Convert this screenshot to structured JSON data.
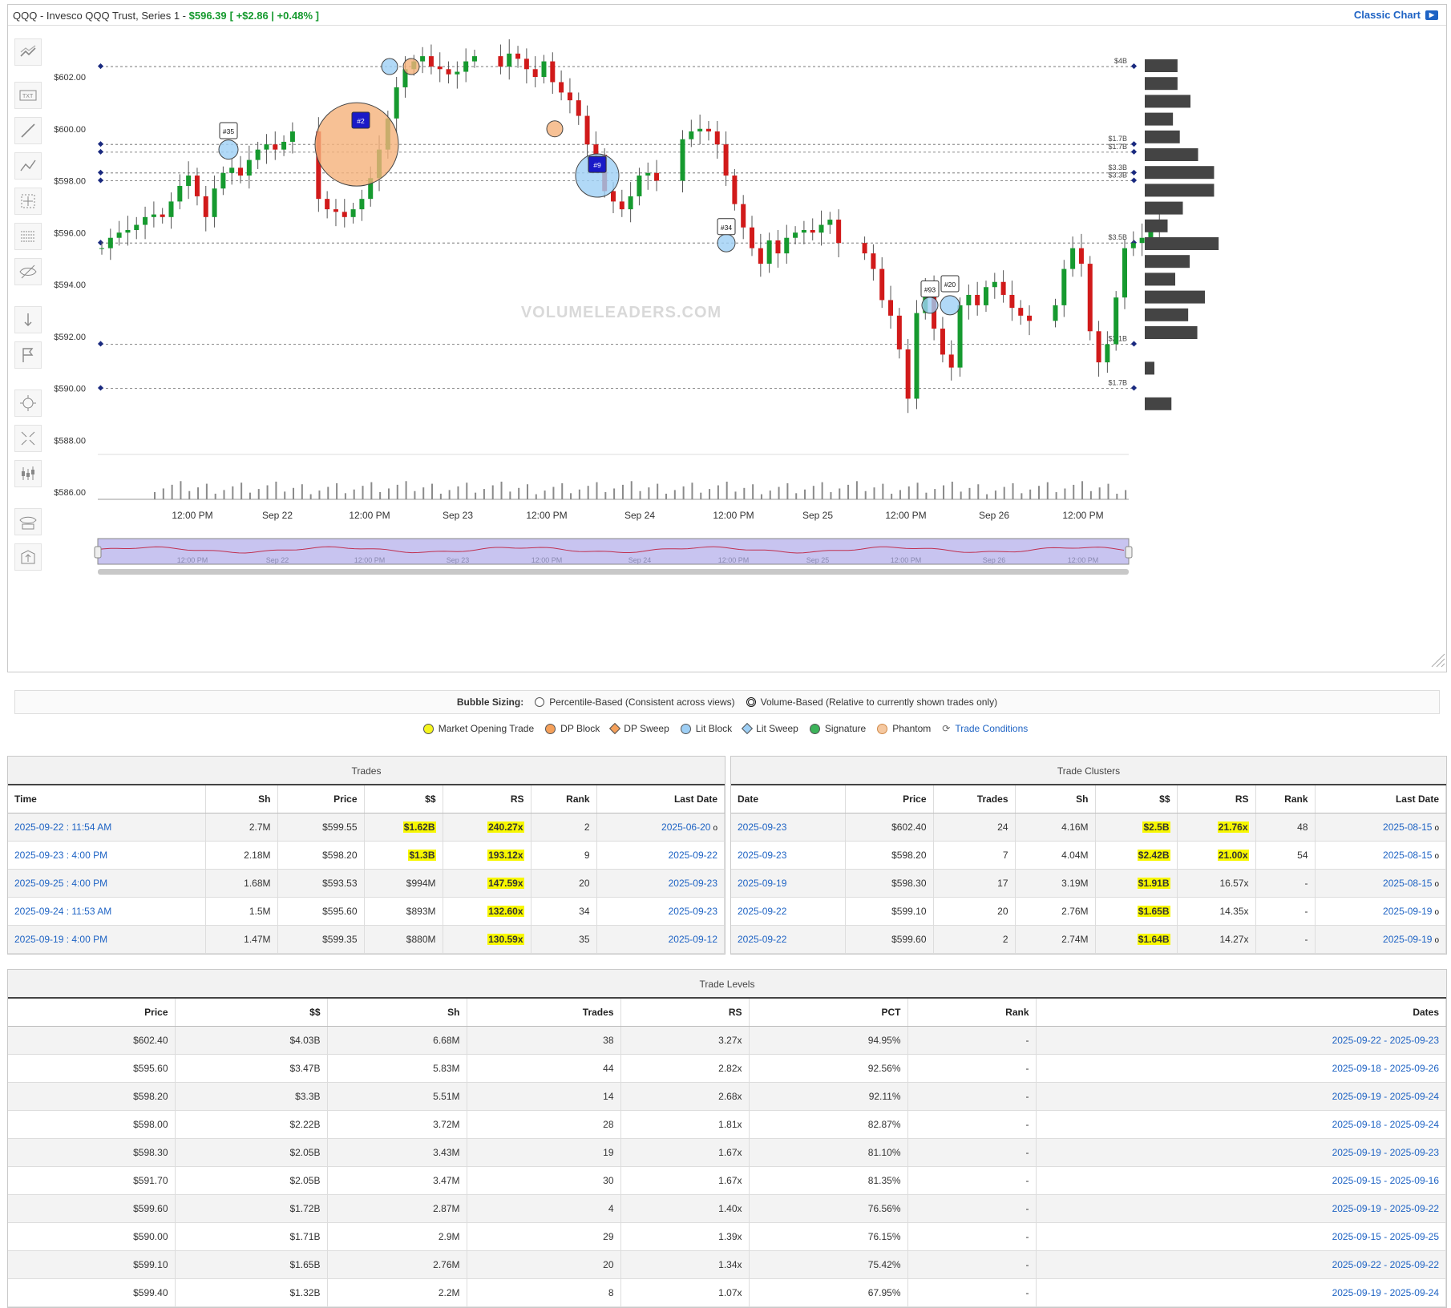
{
  "header": {
    "title_prefix": "QQQ - Invesco QQQ Trust, Series 1  - ",
    "price": "$596.39",
    "change": "[ +$2.86 | +0.48% ]",
    "classic_chart_label": "Classic Chart"
  },
  "chart_data": {
    "type": "candlestick",
    "y_tick_labels": [
      "$602.00",
      "$600.00",
      "$598.00",
      "$596.00",
      "$594.00",
      "$592.00",
      "$590.00",
      "$588.00",
      "$586.00"
    ],
    "ylim": [
      586,
      603
    ],
    "x_tick_labels": [
      "12:00 PM",
      "Sep 22",
      "12:00 PM",
      "Sep 23",
      "12:00 PM",
      "Sep 24",
      "12:00 PM",
      "Sep 25",
      "12:00 PM",
      "Sep 26",
      "12:00 PM"
    ],
    "navigator_labels": [
      "12:00 PM",
      "Sep 22",
      "12:00 PM",
      "Sep 23",
      "12:00 PM",
      "Sep 24",
      "12:00 PM",
      "Sep 25",
      "12:00 PM",
      "Sep 26",
      "12:00 PM"
    ],
    "watermark": "VOLUMELEADERS.COM",
    "levels": [
      {
        "price": 602.4,
        "label": "$4B"
      },
      {
        "price": 599.4,
        "label": "$1.7B"
      },
      {
        "price": 599.1,
        "label": "$1.7B"
      },
      {
        "price": 598.3,
        "label": "$3.3B"
      },
      {
        "price": 598.0,
        "label": "$3.3B"
      },
      {
        "price": 595.6,
        "label": "$3.5B"
      },
      {
        "price": 591.7,
        "label": "$2.1B"
      },
      {
        "price": 590.0,
        "label": "$1.7B"
      }
    ],
    "markers": [
      "#35",
      "#2",
      "#9",
      "#34",
      "#93",
      "#20"
    ],
    "volume_profile": [
      0.43,
      0.43,
      0.6,
      0.37,
      0.46,
      0.7,
      0.91,
      0.91,
      0.5,
      0.3,
      0.97,
      0.59,
      0.4,
      0.79,
      0.57,
      0.69,
      0.0,
      0.1,
      0.0,
      0.35
    ]
  },
  "bubble_sizing": {
    "label": "Bubble Sizing:",
    "option1": "Percentile-Based (Consistent across views)",
    "option2": "Volume-Based (Relative to currently shown trades only)"
  },
  "legend": [
    {
      "label": "Market Opening Trade",
      "color": "#f5f51e",
      "shape": "circle"
    },
    {
      "label": "DP Block",
      "color": "#f5a05a",
      "shape": "circle"
    },
    {
      "label": "DP Sweep",
      "color": "#f5a05a",
      "shape": "diamond"
    },
    {
      "label": "Lit Block",
      "color": "#9ecff5",
      "shape": "circle"
    },
    {
      "label": "Lit Sweep",
      "color": "#9ecff5",
      "shape": "diamond"
    },
    {
      "label": "Signature",
      "color": "#3cb35a",
      "shape": "circle"
    },
    {
      "label": "Phantom",
      "color": "#f5c8a0",
      "shape": "circle"
    }
  ],
  "trade_conditions_label": "Trade Conditions",
  "trades": {
    "title": "Trades",
    "headers": [
      "Time",
      "Sh",
      "Price",
      "$$",
      "RS",
      "Rank",
      "Last Date"
    ],
    "rows": [
      [
        "2025-09-22 : 11:54 AM",
        "2.7M",
        "$599.55",
        "$1.62B",
        "240.27x",
        "2",
        "2025-06-20"
      ],
      [
        "2025-09-23 : 4:00 PM",
        "2.18M",
        "$598.20",
        "$1.3B",
        "193.12x",
        "9",
        "2025-09-22"
      ],
      [
        "2025-09-25 : 4:00 PM",
        "1.68M",
        "$593.53",
        "$994M",
        "147.59x",
        "20",
        "2025-09-23"
      ],
      [
        "2025-09-24 : 11:53 AM",
        "1.5M",
        "$595.60",
        "$893M",
        "132.60x",
        "34",
        "2025-09-23"
      ],
      [
        "2025-09-19 : 4:00 PM",
        "1.47M",
        "$599.35",
        "$880M",
        "130.59x",
        "35",
        "2025-09-12"
      ]
    ]
  },
  "clusters": {
    "title": "Trade Clusters",
    "headers": [
      "Date",
      "Price",
      "Trades",
      "Sh",
      "$$",
      "RS",
      "Rank",
      "Last Date"
    ],
    "rows": [
      [
        "2025-09-23",
        "$602.40",
        "24",
        "4.16M",
        "$2.5B",
        "21.76x",
        "48",
        "2025-08-15"
      ],
      [
        "2025-09-23",
        "$598.20",
        "7",
        "4.04M",
        "$2.42B",
        "21.00x",
        "54",
        "2025-08-15"
      ],
      [
        "2025-09-19",
        "$598.30",
        "17",
        "3.19M",
        "$1.91B",
        "16.57x",
        "-",
        "2025-08-15"
      ],
      [
        "2025-09-22",
        "$599.10",
        "20",
        "2.76M",
        "$1.65B",
        "14.35x",
        "-",
        "2025-09-19"
      ],
      [
        "2025-09-22",
        "$599.60",
        "2",
        "2.74M",
        "$1.64B",
        "14.27x",
        "-",
        "2025-09-19"
      ]
    ]
  },
  "levels_table": {
    "title": "Trade Levels",
    "headers": [
      "Price",
      "$$",
      "Sh",
      "Trades",
      "RS",
      "PCT",
      "Rank",
      "Dates"
    ],
    "rows": [
      [
        "$602.40",
        "$4.03B",
        "6.68M",
        "38",
        "3.27x",
        "94.95%",
        "-",
        "2025-09-22 - 2025-09-23"
      ],
      [
        "$595.60",
        "$3.47B",
        "5.83M",
        "44",
        "2.82x",
        "92.56%",
        "-",
        "2025-09-18 - 2025-09-26"
      ],
      [
        "$598.20",
        "$3.3B",
        "5.51M",
        "14",
        "2.68x",
        "92.11%",
        "-",
        "2025-09-19 - 2025-09-24"
      ],
      [
        "$598.00",
        "$2.22B",
        "3.72M",
        "28",
        "1.81x",
        "82.87%",
        "-",
        "2025-09-18 - 2025-09-24"
      ],
      [
        "$598.30",
        "$2.05B",
        "3.43M",
        "19",
        "1.67x",
        "81.10%",
        "-",
        "2025-09-19 - 2025-09-23"
      ],
      [
        "$591.70",
        "$2.05B",
        "3.47M",
        "30",
        "1.67x",
        "81.35%",
        "-",
        "2025-09-15 - 2025-09-16"
      ],
      [
        "$599.60",
        "$1.72B",
        "2.87M",
        "4",
        "1.40x",
        "76.56%",
        "-",
        "2025-09-19 - 2025-09-22"
      ],
      [
        "$590.00",
        "$1.71B",
        "2.9M",
        "29",
        "1.39x",
        "76.15%",
        "-",
        "2025-09-15 - 2025-09-25"
      ],
      [
        "$599.10",
        "$1.65B",
        "2.76M",
        "20",
        "1.34x",
        "75.42%",
        "-",
        "2025-09-22 - 2025-09-22"
      ],
      [
        "$599.40",
        "$1.32B",
        "2.2M",
        "8",
        "1.07x",
        "67.95%",
        "-",
        "2025-09-19 - 2025-09-24"
      ]
    ]
  }
}
